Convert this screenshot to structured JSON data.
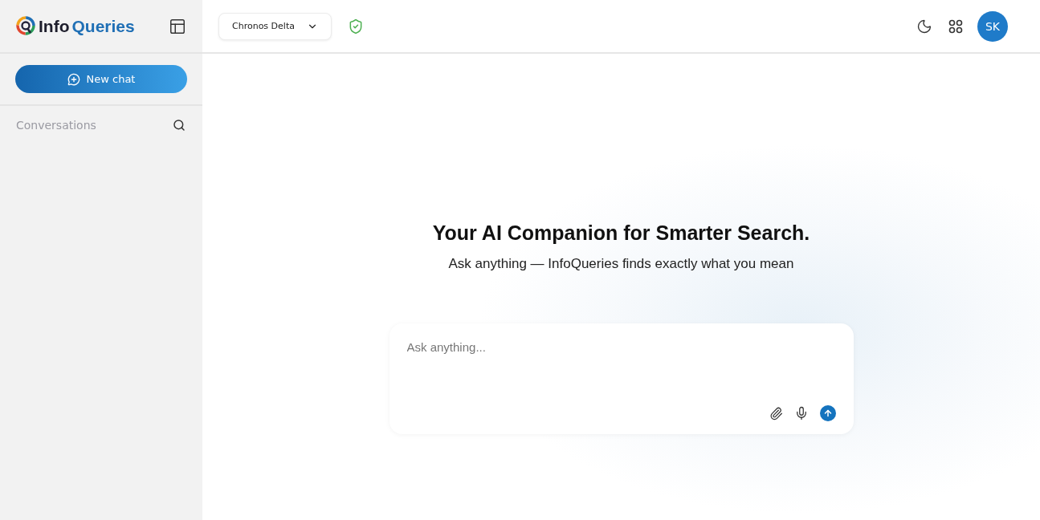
{
  "brand": {
    "first": "Info",
    "second": "Queries"
  },
  "sidebar": {
    "new_chat": "New chat",
    "section_title": "Conversations"
  },
  "header": {
    "workspace": "Chronos Delta",
    "avatar": "SK"
  },
  "hero": {
    "title": "Your AI Companion for Smarter Search.",
    "subtitle": "Ask anything — InfoQueries finds exactly what you mean"
  },
  "composer": {
    "placeholder": "Ask anything..."
  }
}
